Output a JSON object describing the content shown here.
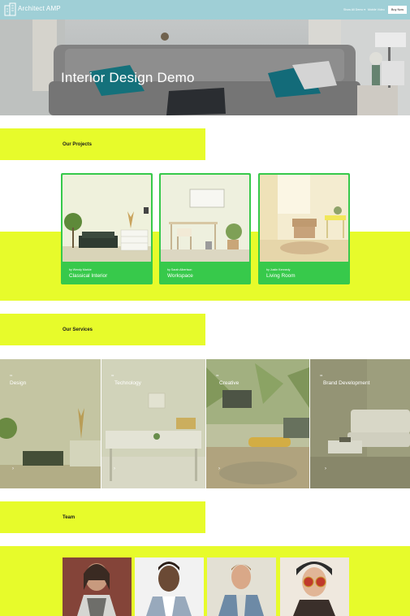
{
  "header": {
    "brand": "Architect AMP",
    "nav": [
      {
        "label": "Show All Demo ▾"
      },
      {
        "label": "Mobile Video"
      }
    ],
    "buy_label": "Buy Now"
  },
  "hero": {
    "title": "Interior Design Demo"
  },
  "projects": {
    "section_title": "Our Projects",
    "items": [
      {
        "author": "by Wendy Markie",
        "name": "Classical Interior"
      },
      {
        "author": "by Sarah Albertson",
        "name": "Workspace"
      },
      {
        "author": "by Justin Kennedy",
        "name": "Living Room"
      }
    ]
  },
  "services": {
    "section_title": "Our Services",
    "items": [
      {
        "tag": "01",
        "title": "Design",
        "arrow": "›"
      },
      {
        "tag": "02",
        "title": "Technology",
        "arrow": "›"
      },
      {
        "tag": "03",
        "title": "Creative",
        "arrow": "›"
      },
      {
        "tag": "04",
        "title": "Brand Development",
        "arrow": "›"
      }
    ]
  },
  "team": {
    "section_title": "Team"
  },
  "colors": {
    "header": "#9fcfd6",
    "lime": "#e7fb2b",
    "card_green": "#37c94b"
  }
}
